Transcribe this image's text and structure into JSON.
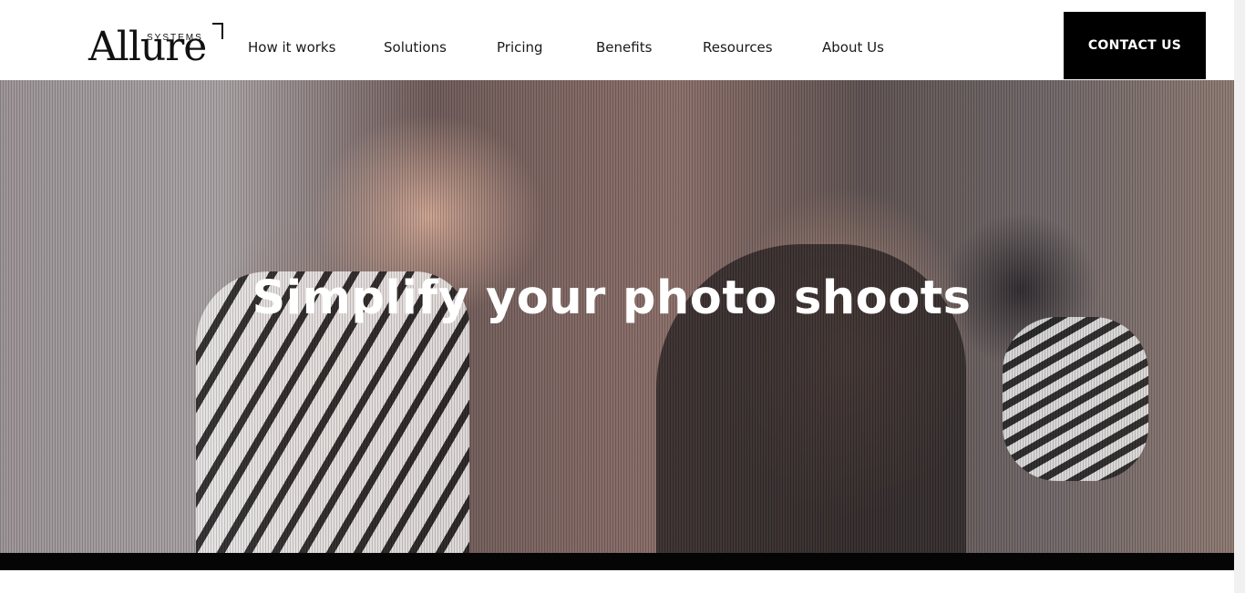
{
  "logo": {
    "word": "Allure",
    "sub": "SYSTEMS"
  },
  "nav": {
    "items": [
      {
        "label": "How it works"
      },
      {
        "label": "Solutions"
      },
      {
        "label": "Pricing"
      },
      {
        "label": "Benefits"
      },
      {
        "label": "Resources"
      },
      {
        "label": "About Us"
      }
    ]
  },
  "contact_label": "CONTACT US",
  "hero": {
    "title": "Simplify your photo shoots"
  },
  "colors": {
    "accent": "#000000",
    "hero_text": "#ffffff"
  }
}
